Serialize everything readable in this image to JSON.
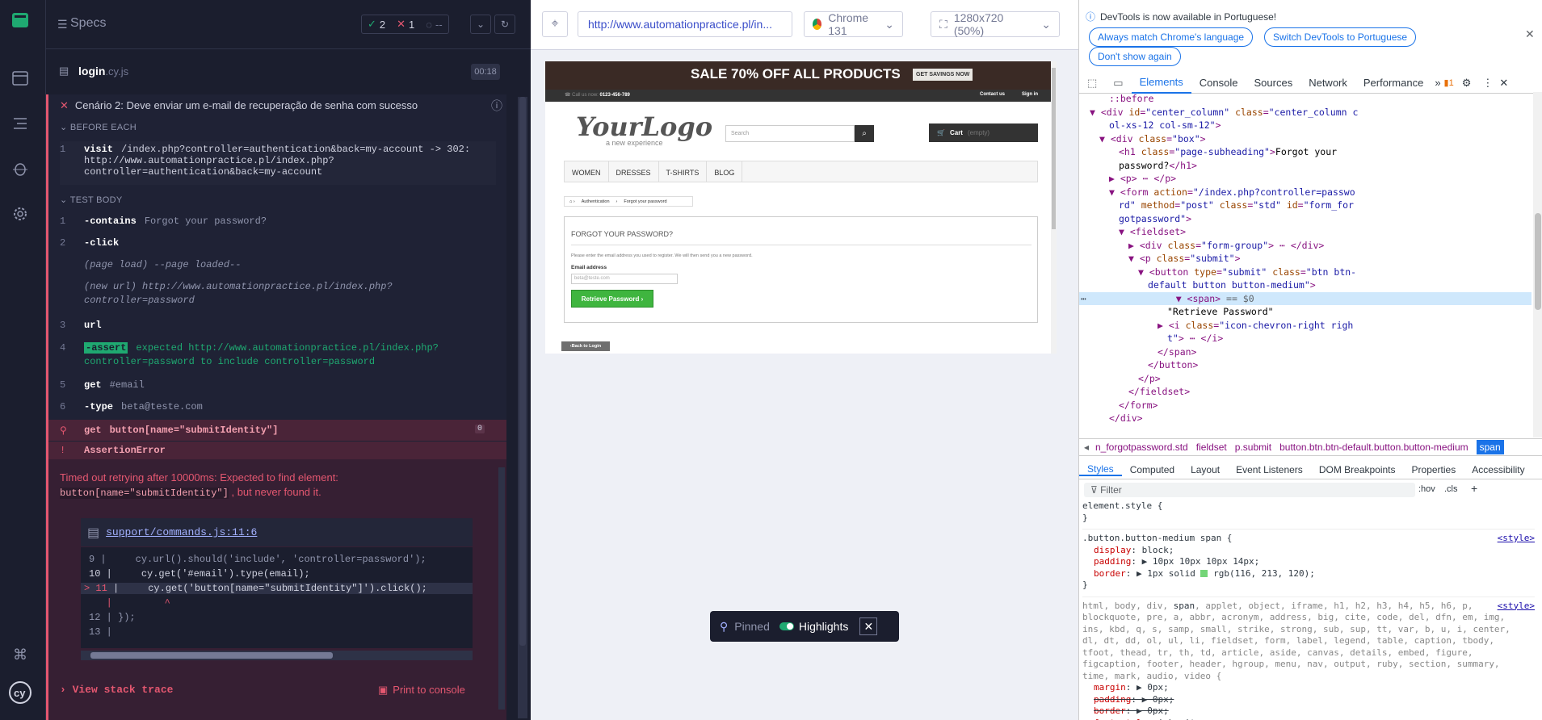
{
  "reporter": {
    "specs_label": "Specs",
    "passed": "2",
    "failed": "1",
    "pending": "--",
    "file_name": "login",
    "file_ext": ".cy.js",
    "file_time": "00:18",
    "test_title": "Cenário 2: Deve enviar um e-mail de recuperação de senha com sucesso",
    "before_each_label": "BEFORE EACH",
    "before_cmd": {
      "num": "1",
      "name": "visit",
      "arg": "/index.php?controller=authentication&back=my-account -> 302:",
      "arg2": "http://www.automationpractice.pl/index.php?",
      "arg3": "controller=authentication&back=my-account"
    },
    "test_body_label": "TEST BODY",
    "commands": [
      {
        "num": "1",
        "name": "-contains",
        "arg": "Forgot your password?"
      },
      {
        "num": "2",
        "name": "-click",
        "arg": ""
      },
      {
        "num": "",
        "name": "",
        "arg": "(page load)  --page loaded--"
      },
      {
        "num": "",
        "name": "",
        "arg": "(new url)  http://www.automationpractice.pl/index.php?"
      },
      {
        "num": "",
        "name": "",
        "arg": "controller=password"
      },
      {
        "num": "3",
        "name": "url",
        "arg": ""
      },
      {
        "num": "4",
        "name": "-assert",
        "arg": "expected  http://www.automationpractice.pl/index.php?"
      },
      {
        "num": "",
        "name": "",
        "arg": "controller=password  to include  controller=password"
      },
      {
        "num": "5",
        "name": "get",
        "arg": "#email"
      },
      {
        "num": "6",
        "name": "-type",
        "arg": "beta@teste.com"
      }
    ],
    "failed_cmd": {
      "name": "get",
      "arg": "button[name=\"submitIdentity\"]",
      "count": "0"
    },
    "error_type": "AssertionError",
    "error_msg_1": "Timed out retrying after 10000ms: Expected to find element:",
    "error_code": "button[name=\"submitIdentity\"]",
    "error_msg_2": ", but never found it.",
    "code_file": "support/commands.js:11:6",
    "code_lines": [
      {
        "n": "9",
        "t": "     cy.url().should('include', 'controller=password');"
      },
      {
        "n": "10",
        "t": "     cy.get('#email').type(email);"
      },
      {
        "n": "> 11",
        "t": "     cy.get('button[name=\"submitIdentity\"]').click();"
      },
      {
        "n": "",
        "t": "         ^"
      },
      {
        "n": "12",
        "t": " });"
      },
      {
        "n": "13",
        "t": ""
      }
    ],
    "stack_trace": "View stack trace",
    "print_console": "Print to console"
  },
  "browser": {
    "url": "http://www.automationpractice.pl/in...",
    "browser_name": "Chrome 131",
    "viewport": "1280x720 (50%)",
    "banner": "SALE 70% OFF ALL PRODUCTS",
    "banner_btn": "GET SAVINGS NOW",
    "call_us": "Call us now:",
    "phone": "0123-456-789",
    "contact": "Contact us",
    "signin": "Sign in",
    "logo": "YourLogo",
    "logo_sub": "a new experience",
    "search_placeholder": "Search",
    "cart": "Cart",
    "cart_empty": "(empty)",
    "menu": [
      "WOMEN",
      "DRESSES",
      "T-SHIRTS",
      "BLOG"
    ],
    "crumb1": "Authentication",
    "crumb2": "Forgot your password",
    "heading": "FORGOT YOUR PASSWORD?",
    "instructions": "Please enter the email address you used to register. We will then send you a new password.",
    "email_label": "Email address",
    "email_value": "beta@teste.com",
    "retrieve_btn": "Retrieve Password",
    "back_login": "Back to Login",
    "pinned": "Pinned",
    "highlights": "Highlights"
  },
  "devtools": {
    "notice": "DevTools is now available in Portuguese!",
    "btn_match": "Always match Chrome's language",
    "btn_switch": "Switch DevTools to Portuguese",
    "btn_dont": "Don't show again",
    "tabs": [
      "Elements",
      "Console",
      "Sources",
      "Network",
      "Performance"
    ],
    "badge": "1",
    "breadcrumbs": [
      "n_forgotpassword.std",
      "fieldset",
      "p.submit",
      "button.btn.btn-default.button.button-medium",
      "span"
    ],
    "style_tabs": [
      "Styles",
      "Computed",
      "Layout",
      "Event Listeners",
      "DOM Breakpoints",
      "Properties",
      "Accessibility"
    ],
    "filter": "Filter",
    "hov": ":hov",
    ".cls": ".cls"
  }
}
